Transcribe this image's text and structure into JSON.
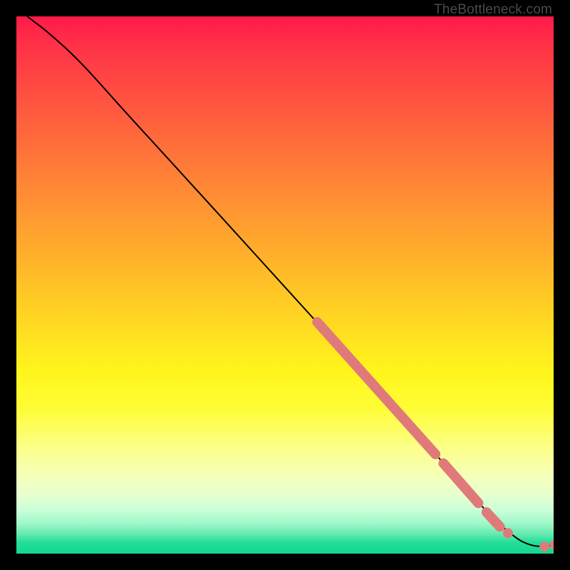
{
  "watermark": "TheBottleneck.com",
  "chart_data": {
    "type": "line",
    "title": "",
    "xlabel": "",
    "ylabel": "",
    "xlim": [
      0,
      100
    ],
    "ylim": [
      0,
      100
    ],
    "curve": [
      {
        "x": 2,
        "y": 100
      },
      {
        "x": 6,
        "y": 97
      },
      {
        "x": 12,
        "y": 91.5
      },
      {
        "x": 20,
        "y": 82.5
      },
      {
        "x": 30,
        "y": 71.6
      },
      {
        "x": 40,
        "y": 60.6
      },
      {
        "x": 50,
        "y": 49.6
      },
      {
        "x": 60,
        "y": 38.6
      },
      {
        "x": 70,
        "y": 27.5
      },
      {
        "x": 80,
        "y": 16.3
      },
      {
        "x": 88,
        "y": 7.2
      },
      {
        "x": 93,
        "y": 2.8
      },
      {
        "x": 95.5,
        "y": 1.6
      },
      {
        "x": 97.5,
        "y": 1.3
      },
      {
        "x": 99.5,
        "y": 1.5
      }
    ],
    "highlight_segments": [
      {
        "x1": 56,
        "y1": 43.1,
        "x2": 78,
        "y2": 18.5
      },
      {
        "x1": 79.5,
        "y1": 16.8,
        "x2": 86,
        "y2": 9.4
      },
      {
        "x1": 87.5,
        "y1": 7.7,
        "x2": 90,
        "y2": 5.0
      }
    ],
    "highlight_points": [
      {
        "x": 91.5,
        "y": 3.8
      },
      {
        "x": 98.3,
        "y": 1.3
      },
      {
        "x": 100.2,
        "y": 1.6
      }
    ],
    "gradient_stops": [
      {
        "pos": 0,
        "color": "#ff1a49"
      },
      {
        "pos": 50,
        "color": "#ffc028"
      },
      {
        "pos": 72,
        "color": "#fffc20"
      },
      {
        "pos": 100,
        "color": "#14d890"
      }
    ]
  }
}
